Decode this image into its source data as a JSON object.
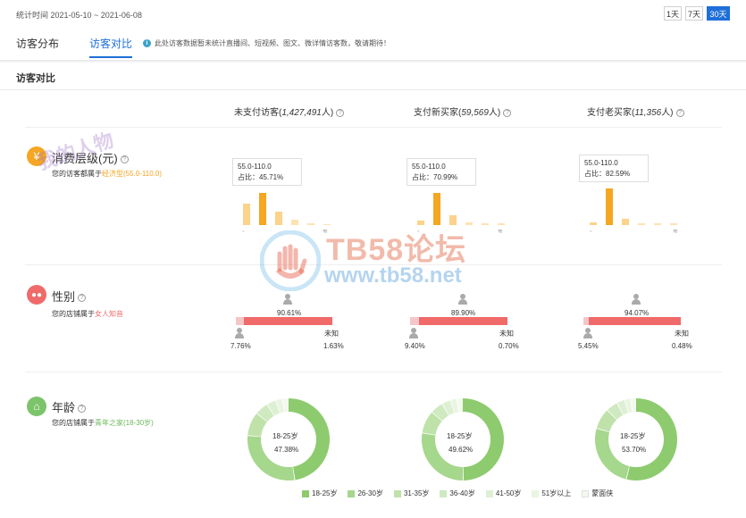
{
  "header": {
    "daterange": "统计时间 2021-05-10 ~ 2021-06-08",
    "ranges": [
      {
        "label": "1天",
        "active": false
      },
      {
        "label": "7天",
        "active": false
      },
      {
        "label": "30天",
        "active": true
      }
    ]
  },
  "tabs": [
    {
      "label": "访客分布",
      "active": false
    },
    {
      "label": "访客对比",
      "active": true
    }
  ],
  "notice": "此处访客数据暂未统计直播间、短视频、图文、微详情访客数，敬请期待！",
  "panel": {
    "title": "访客对比",
    "columns": [
      {
        "label": "未支付访客(",
        "count": "1,427,491",
        "suffix": "人)"
      },
      {
        "label": "支付新买家(",
        "count": "59,569",
        "suffix": "人)"
      },
      {
        "label": "支付老买家(",
        "count": "11,356",
        "suffix": "人)"
      }
    ]
  },
  "consumption": {
    "title": "消费层级(元)",
    "desc_prefix": "您的访客都属于",
    "desc_value": "经济型(55.0-110.0)",
    "icon": "yen-icon",
    "color": "#f5a623",
    "columns": [
      {
        "range": "55.0-110.0",
        "share": "占比：45.71%"
      },
      {
        "range": "55.0-110.0",
        "share": "占比：70.99%"
      },
      {
        "range": "55.0-110.0",
        "share": "占比：82.59%"
      }
    ]
  },
  "gender": {
    "title": "性别",
    "desc_prefix": "您的店铺属于",
    "desc_value": "女人知音",
    "icon": "people-icon",
    "color": "#f06a6a",
    "unknown_label": "未知",
    "columns": [
      {
        "female_pct": "90.61%",
        "male_pct": "7.76%",
        "unknown_pct": "1.63%",
        "female": 90.61,
        "male": 7.76
      },
      {
        "female_pct": "89.90%",
        "male_pct": "9.40%",
        "unknown_pct": "0.70%",
        "female": 89.9,
        "male": 9.4
      },
      {
        "female_pct": "94.07%",
        "male_pct": "5.45%",
        "unknown_pct": "0.48%",
        "female": 94.07,
        "male": 5.45
      }
    ]
  },
  "age": {
    "title": "年龄",
    "desc_prefix": "您的店铺属于",
    "desc_value": "青年之家(18-30岁)",
    "icon": "house-icon",
    "color": "#7cc46a",
    "columns": [
      {
        "center_label": "18-25岁",
        "center_value": "47.38%"
      },
      {
        "center_label": "18-25岁",
        "center_value": "49.62%"
      },
      {
        "center_label": "18-25岁",
        "center_value": "53.70%"
      }
    ],
    "legend": [
      {
        "label": "18-25岁",
        "color": "#8dcb6e"
      },
      {
        "label": "26-30岁",
        "color": "#a5d78c"
      },
      {
        "label": "31-35岁",
        "color": "#bfe2aa"
      },
      {
        "label": "36-40岁",
        "color": "#cfe9c0"
      },
      {
        "label": "41-50岁",
        "color": "#ddf0d3"
      },
      {
        "label": "51岁以上",
        "color": "#e9f5e2"
      },
      {
        "label": "蒙面侠",
        "color": "#f3f9ef"
      }
    ]
  },
  "watermark": {
    "brand": "TB58论坛",
    "url": "www.tb58.net",
    "stamp": "我的人物"
  }
}
